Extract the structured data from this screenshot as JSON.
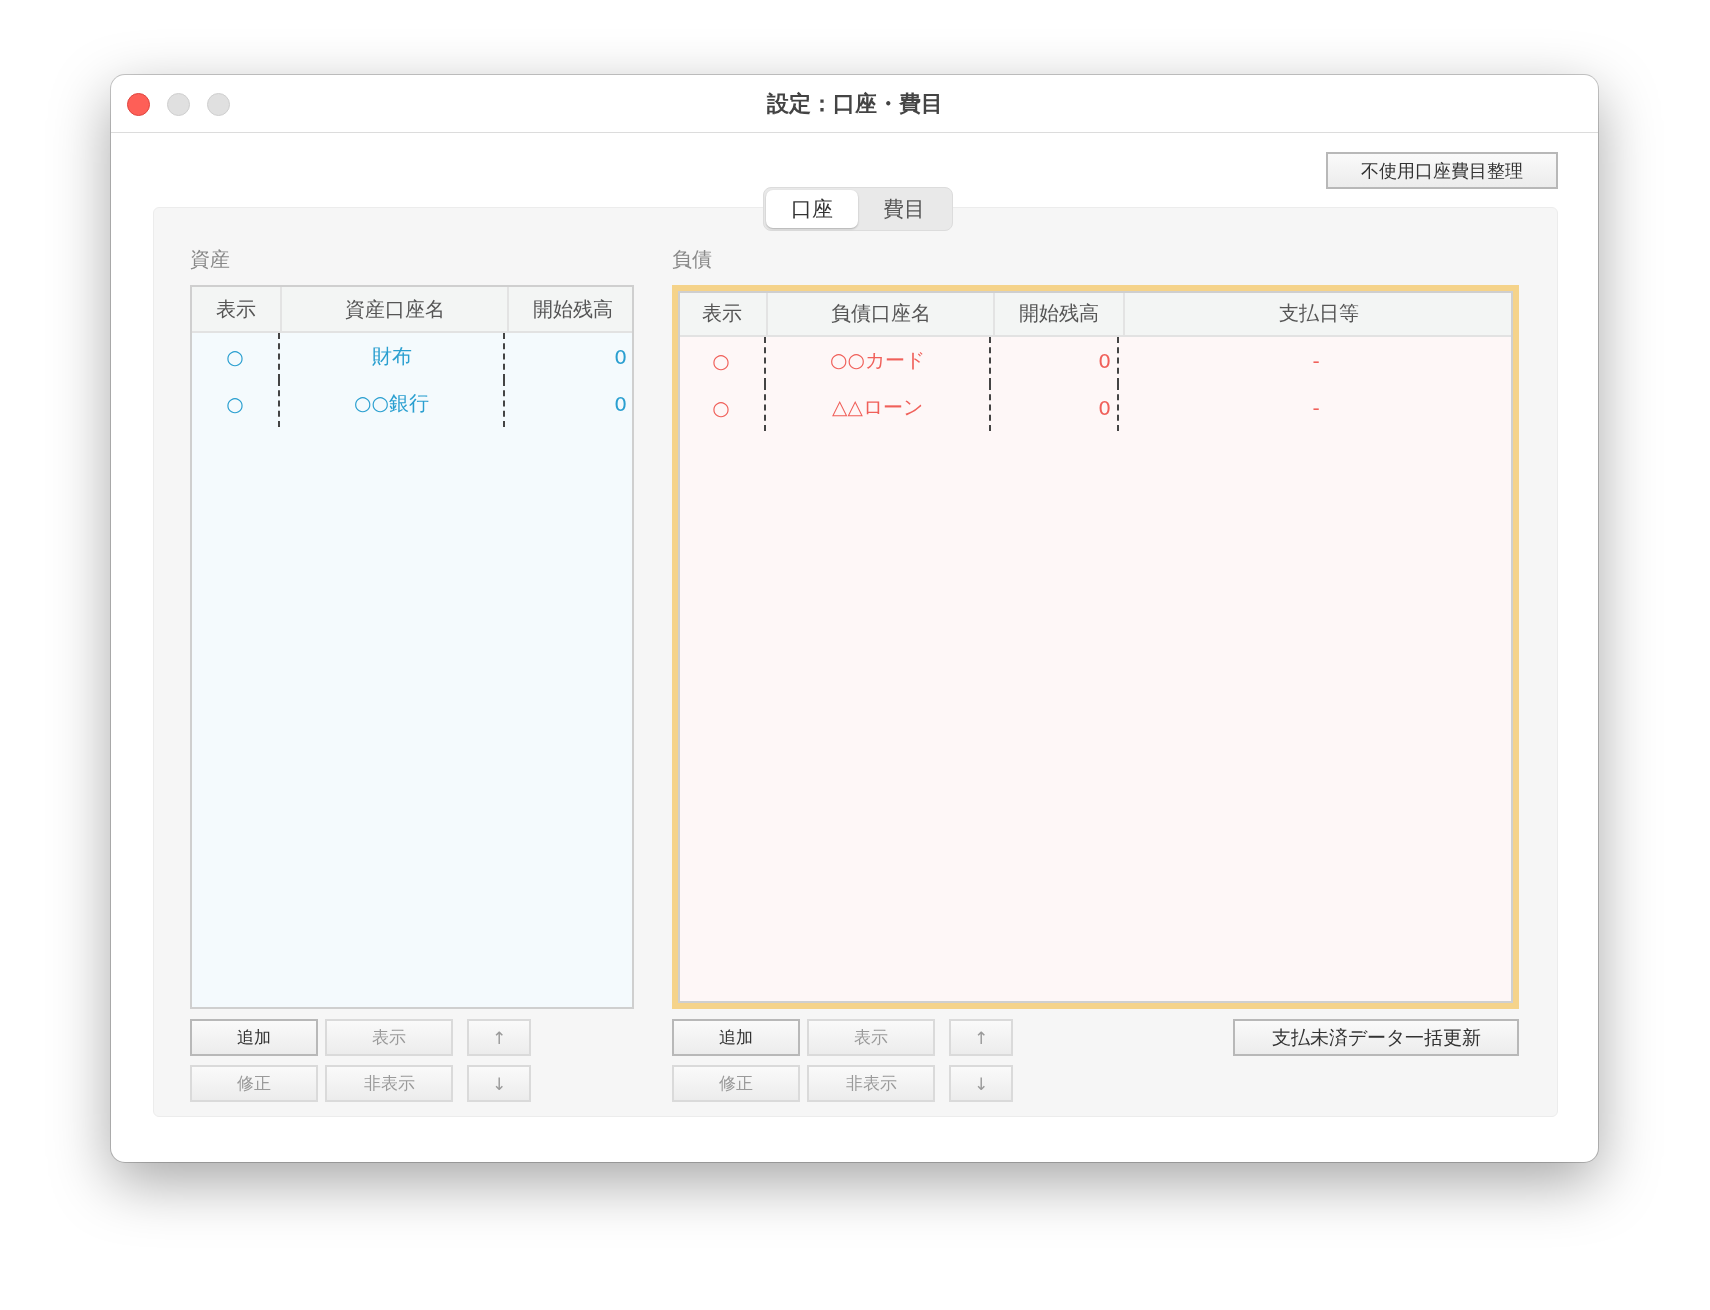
{
  "window": {
    "title": "設定：口座・費目"
  },
  "top_button": {
    "label": "不使用口座費目整理"
  },
  "tabs": [
    {
      "label": "口座",
      "selected": true
    },
    {
      "label": "費目",
      "selected": false
    }
  ],
  "panels": [
    {
      "title": "資産",
      "selected": false,
      "color": "#2a9fd0",
      "columns": [
        "表示",
        "資産口座名",
        "開始残高"
      ],
      "rows": [
        {
          "cells": [
            "○",
            "財布",
            "0"
          ]
        },
        {
          "cells": [
            "○",
            "○○銀行",
            "0"
          ]
        }
      ],
      "buttons": [
        {
          "label": "追加",
          "disabled": false
        },
        {
          "label": "表示",
          "disabled": true
        },
        {
          "label": "↑",
          "disabled": true
        },
        {
          "label": "修正",
          "disabled": true
        },
        {
          "label": "非表示",
          "disabled": true
        },
        {
          "label": "↓",
          "disabled": true
        }
      ]
    },
    {
      "title": "負債",
      "selected": true,
      "color": "#f0605a",
      "columns": [
        "表示",
        "負債口座名",
        "開始残高",
        "支払日等"
      ],
      "rows": [
        {
          "cells": [
            "○",
            "○○カード",
            "0",
            "-"
          ]
        },
        {
          "cells": [
            "○",
            "△△ローン",
            "0",
            "-"
          ]
        }
      ],
      "buttons": [
        {
          "label": "追加",
          "disabled": false
        },
        {
          "label": "表示",
          "disabled": true
        },
        {
          "label": "↑",
          "disabled": true
        },
        {
          "label": "修正",
          "disabled": true
        },
        {
          "label": "非表示",
          "disabled": true
        },
        {
          "label": "↓",
          "disabled": true
        }
      ],
      "extra_button": {
        "label": "支払未済データ一括更新"
      }
    }
  ]
}
